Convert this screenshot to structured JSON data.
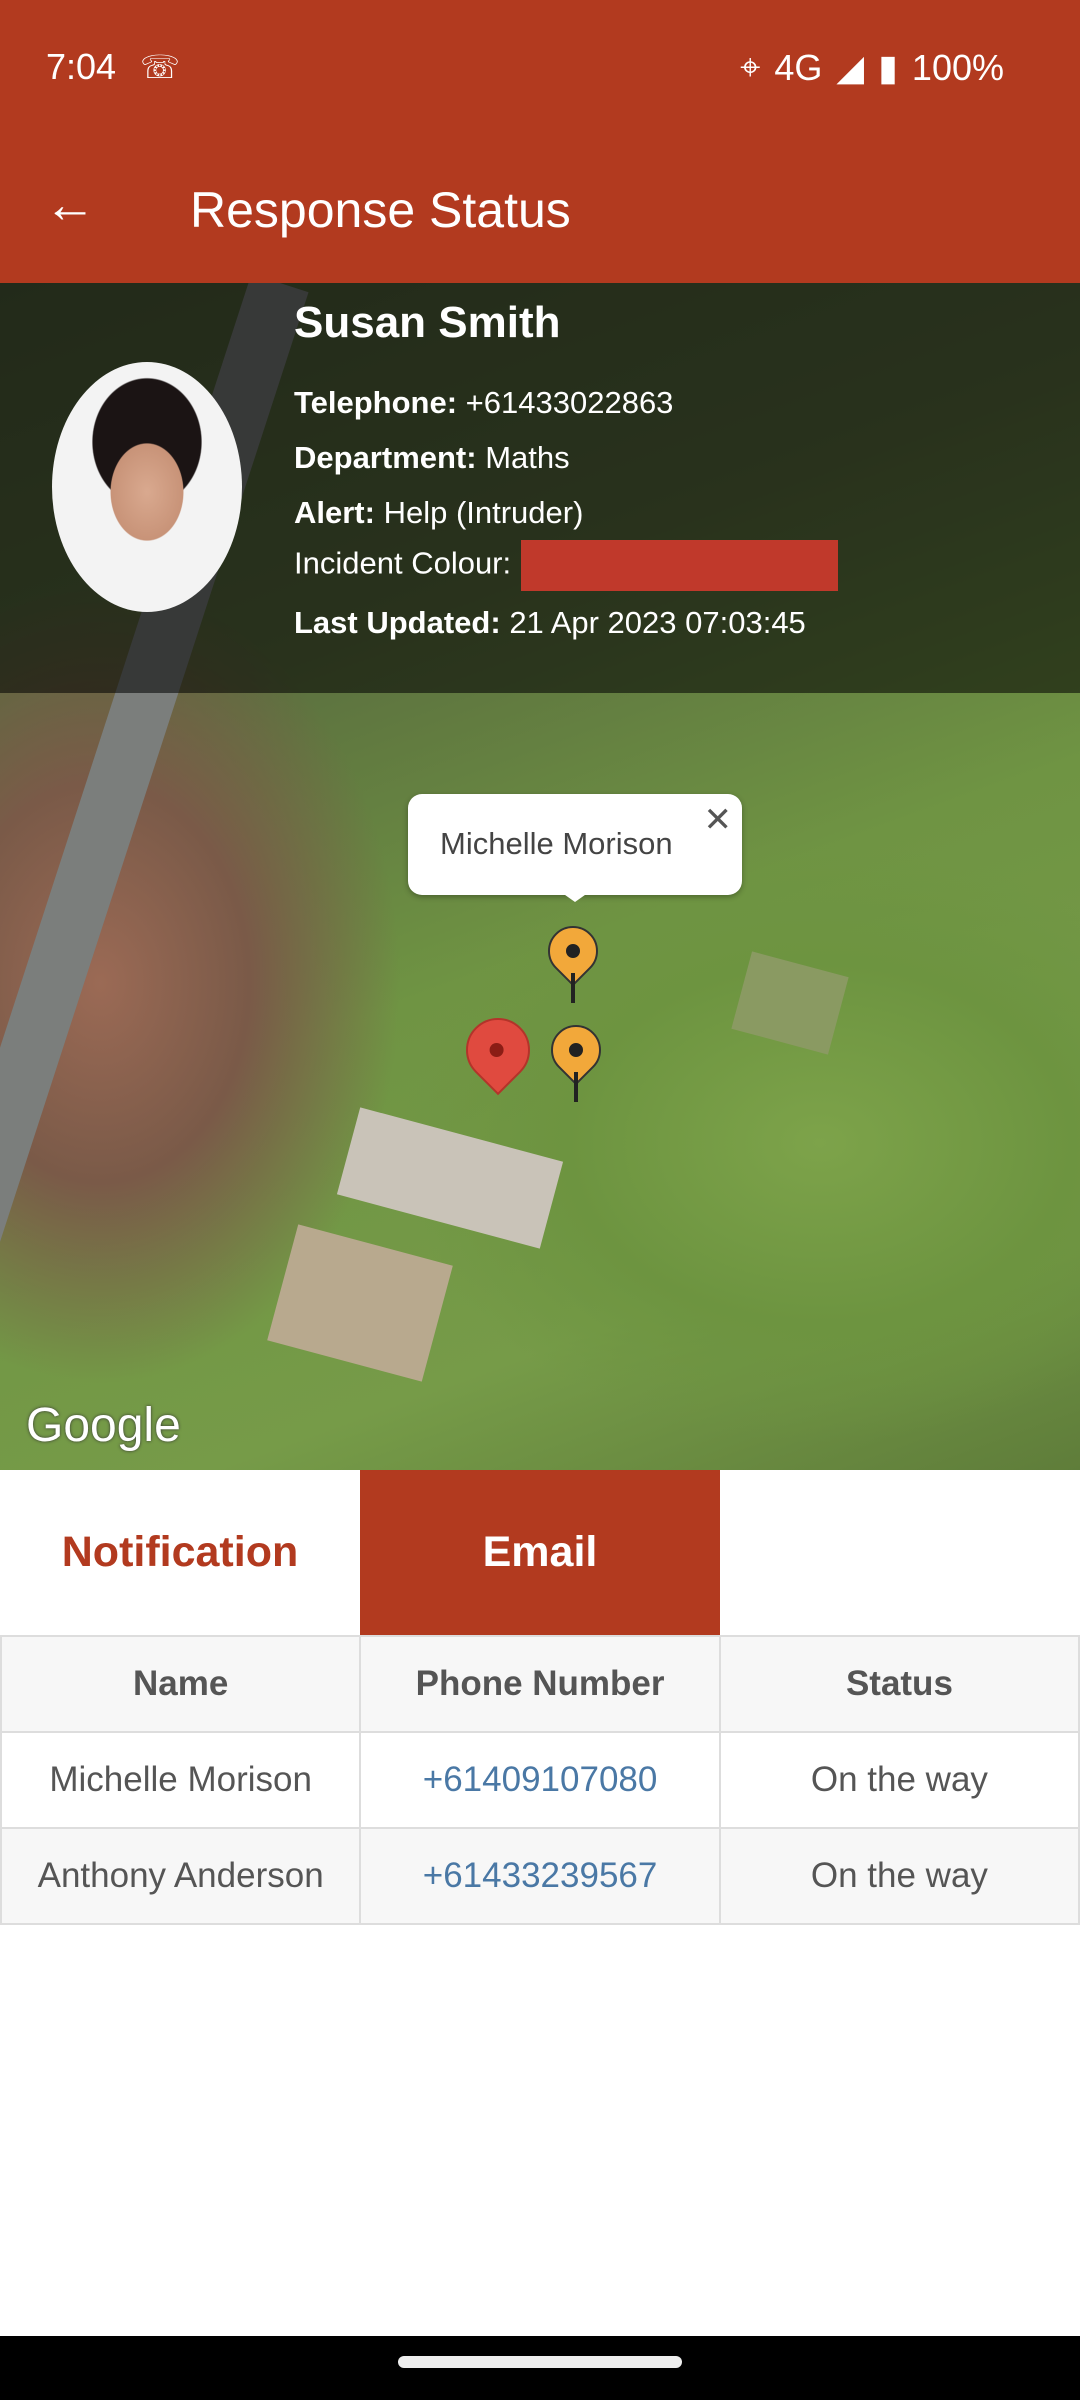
{
  "status_bar": {
    "time": "7:04",
    "network": "4G",
    "battery": "100%"
  },
  "app_bar": {
    "title": "Response Status"
  },
  "profile": {
    "name": "Susan Smith",
    "telephone_label": "Telephone:",
    "telephone": "+61433022863",
    "department_label": "Department:",
    "department": "Maths",
    "alert_label": "Alert:",
    "alert": "Help (Intruder)",
    "incident_colour_label": "Incident Colour:",
    "incident_colour": "#C0392B",
    "last_updated_label": "Last Updated:",
    "last_updated": "21 Apr 2023 07:03:45"
  },
  "map": {
    "info_window": "Michelle Morison",
    "attribution": "Google",
    "pin_colors": {
      "responder": "#F2A83A",
      "alert": "#E04A3F"
    }
  },
  "tabs": [
    {
      "label": "Notification",
      "active": false
    },
    {
      "label": "Email",
      "active": true
    }
  ],
  "table": {
    "headers": [
      "Name",
      "Phone Number",
      "Status"
    ],
    "rows": [
      {
        "name": "Michelle Morison",
        "phone": "+61409107080",
        "status": "On the way"
      },
      {
        "name": "Anthony Anderson",
        "phone": "+61433239567",
        "status": "On the way"
      }
    ]
  }
}
